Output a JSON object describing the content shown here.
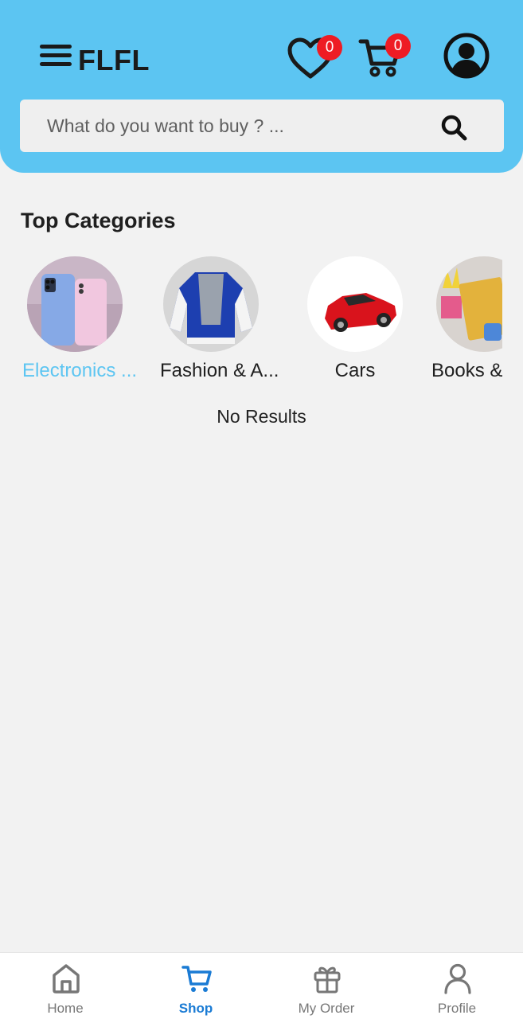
{
  "header": {
    "logo": "FLFL",
    "wishlist_count": "0",
    "cart_count": "0"
  },
  "search": {
    "placeholder": "What do you want to buy ? ..."
  },
  "categories": {
    "title": "Top Categories",
    "items": [
      {
        "label": "Electronics ...",
        "active": true
      },
      {
        "label": "Fashion & A...",
        "active": false
      },
      {
        "label": "Cars",
        "active": false
      },
      {
        "label": "Books &",
        "active": false
      }
    ]
  },
  "results": {
    "empty_text": "No Results"
  },
  "bottom_nav": {
    "items": [
      {
        "label": "Home",
        "icon": "home-icon"
      },
      {
        "label": "Shop",
        "icon": "cart-icon",
        "active": true
      },
      {
        "label": "My Order",
        "icon": "gift-icon"
      },
      {
        "label": "Profile",
        "icon": "user-icon"
      }
    ]
  },
  "colors": {
    "header_bg": "#5cc5f2",
    "active_category": "#5cc5f2",
    "active_nav": "#1a7bd4",
    "badge": "#ee1c24"
  }
}
